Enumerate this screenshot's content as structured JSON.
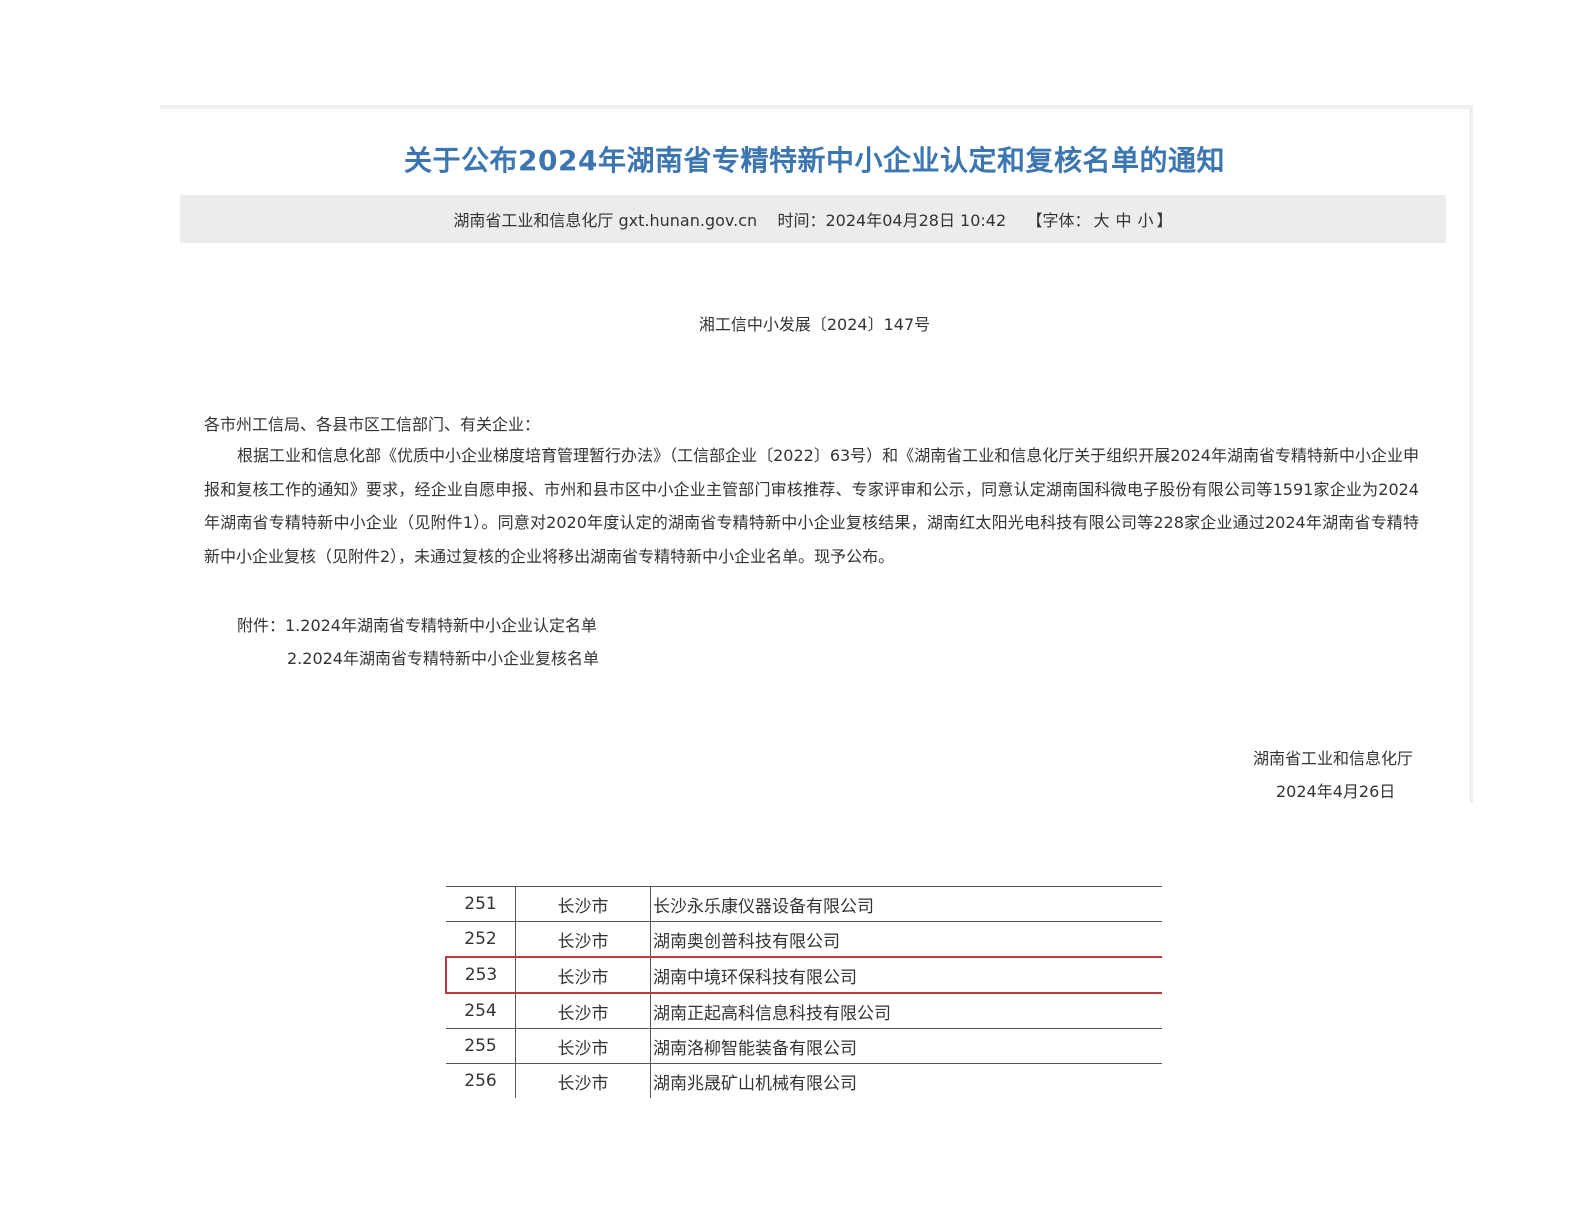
{
  "article": {
    "title": "关于公布2024年湖南省专精特新中小企业认定和复核名单的通知",
    "meta": {
      "source": "湖南省工业和信息化厅 gxt.hunan.gov.cn",
      "time_label": "时间：2024年04月28日 10:42",
      "font_open": "【字体：",
      "font_large": "大",
      "font_medium": "中",
      "font_small": "小",
      "font_close": "】"
    },
    "doc_number": "湘工信中小发展〔2024〕147号",
    "salutation": "各市州工信局、各县市区工信部门、有关企业：",
    "body": "根据工业和信息化部《优质中小企业梯度培育管理暂行办法》（工信部企业〔2022〕63号）和《湖南省工业和信息化厅关于组织开展2024年湖南省专精特新中小企业申报和复核工作的通知》要求，经企业自愿申报、市州和县市区中小企业主管部门审核推荐、专家评审和公示，同意认定湖南国科微电子股份有限公司等1591家企业为2024年湖南省专精特新中小企业（见附件1）。同意对2020年度认定的湖南省专精特新中小企业复核结果，湖南红太阳光电科技有限公司等228家企业通过2024年湖南省专精特新中小企业复核（见附件2），未通过复核的企业将移出湖南省专精特新中小企业名单。现予公布。",
    "attachments": [
      "附件：1.2024年湖南省专精特新中小企业认定名单",
      "2.2024年湖南省专精特新中小企业复核名单"
    ],
    "signature_org": "湖南省工业和信息化厅",
    "signature_date": "2024年4月26日"
  },
  "list": {
    "rows": [
      {
        "no": "251",
        "city": "长沙市",
        "name": "长沙永乐康仪器设备有限公司"
      },
      {
        "no": "252",
        "city": "长沙市",
        "name": "湖南奥创普科技有限公司"
      },
      {
        "no": "253",
        "city": "长沙市",
        "name": "湖南中境环保科技有限公司"
      },
      {
        "no": "254",
        "city": "长沙市",
        "name": "湖南正起高科信息科技有限公司"
      },
      {
        "no": "255",
        "city": "长沙市",
        "name": "湖南洛柳智能装备有限公司"
      },
      {
        "no": "256",
        "city": "长沙市",
        "name": "湖南兆晟矿山机械有限公司"
      }
    ],
    "highlight_color": "#c0393b"
  },
  "colors": {
    "title": "#3c76b1",
    "meta_bar": "#ececec"
  }
}
